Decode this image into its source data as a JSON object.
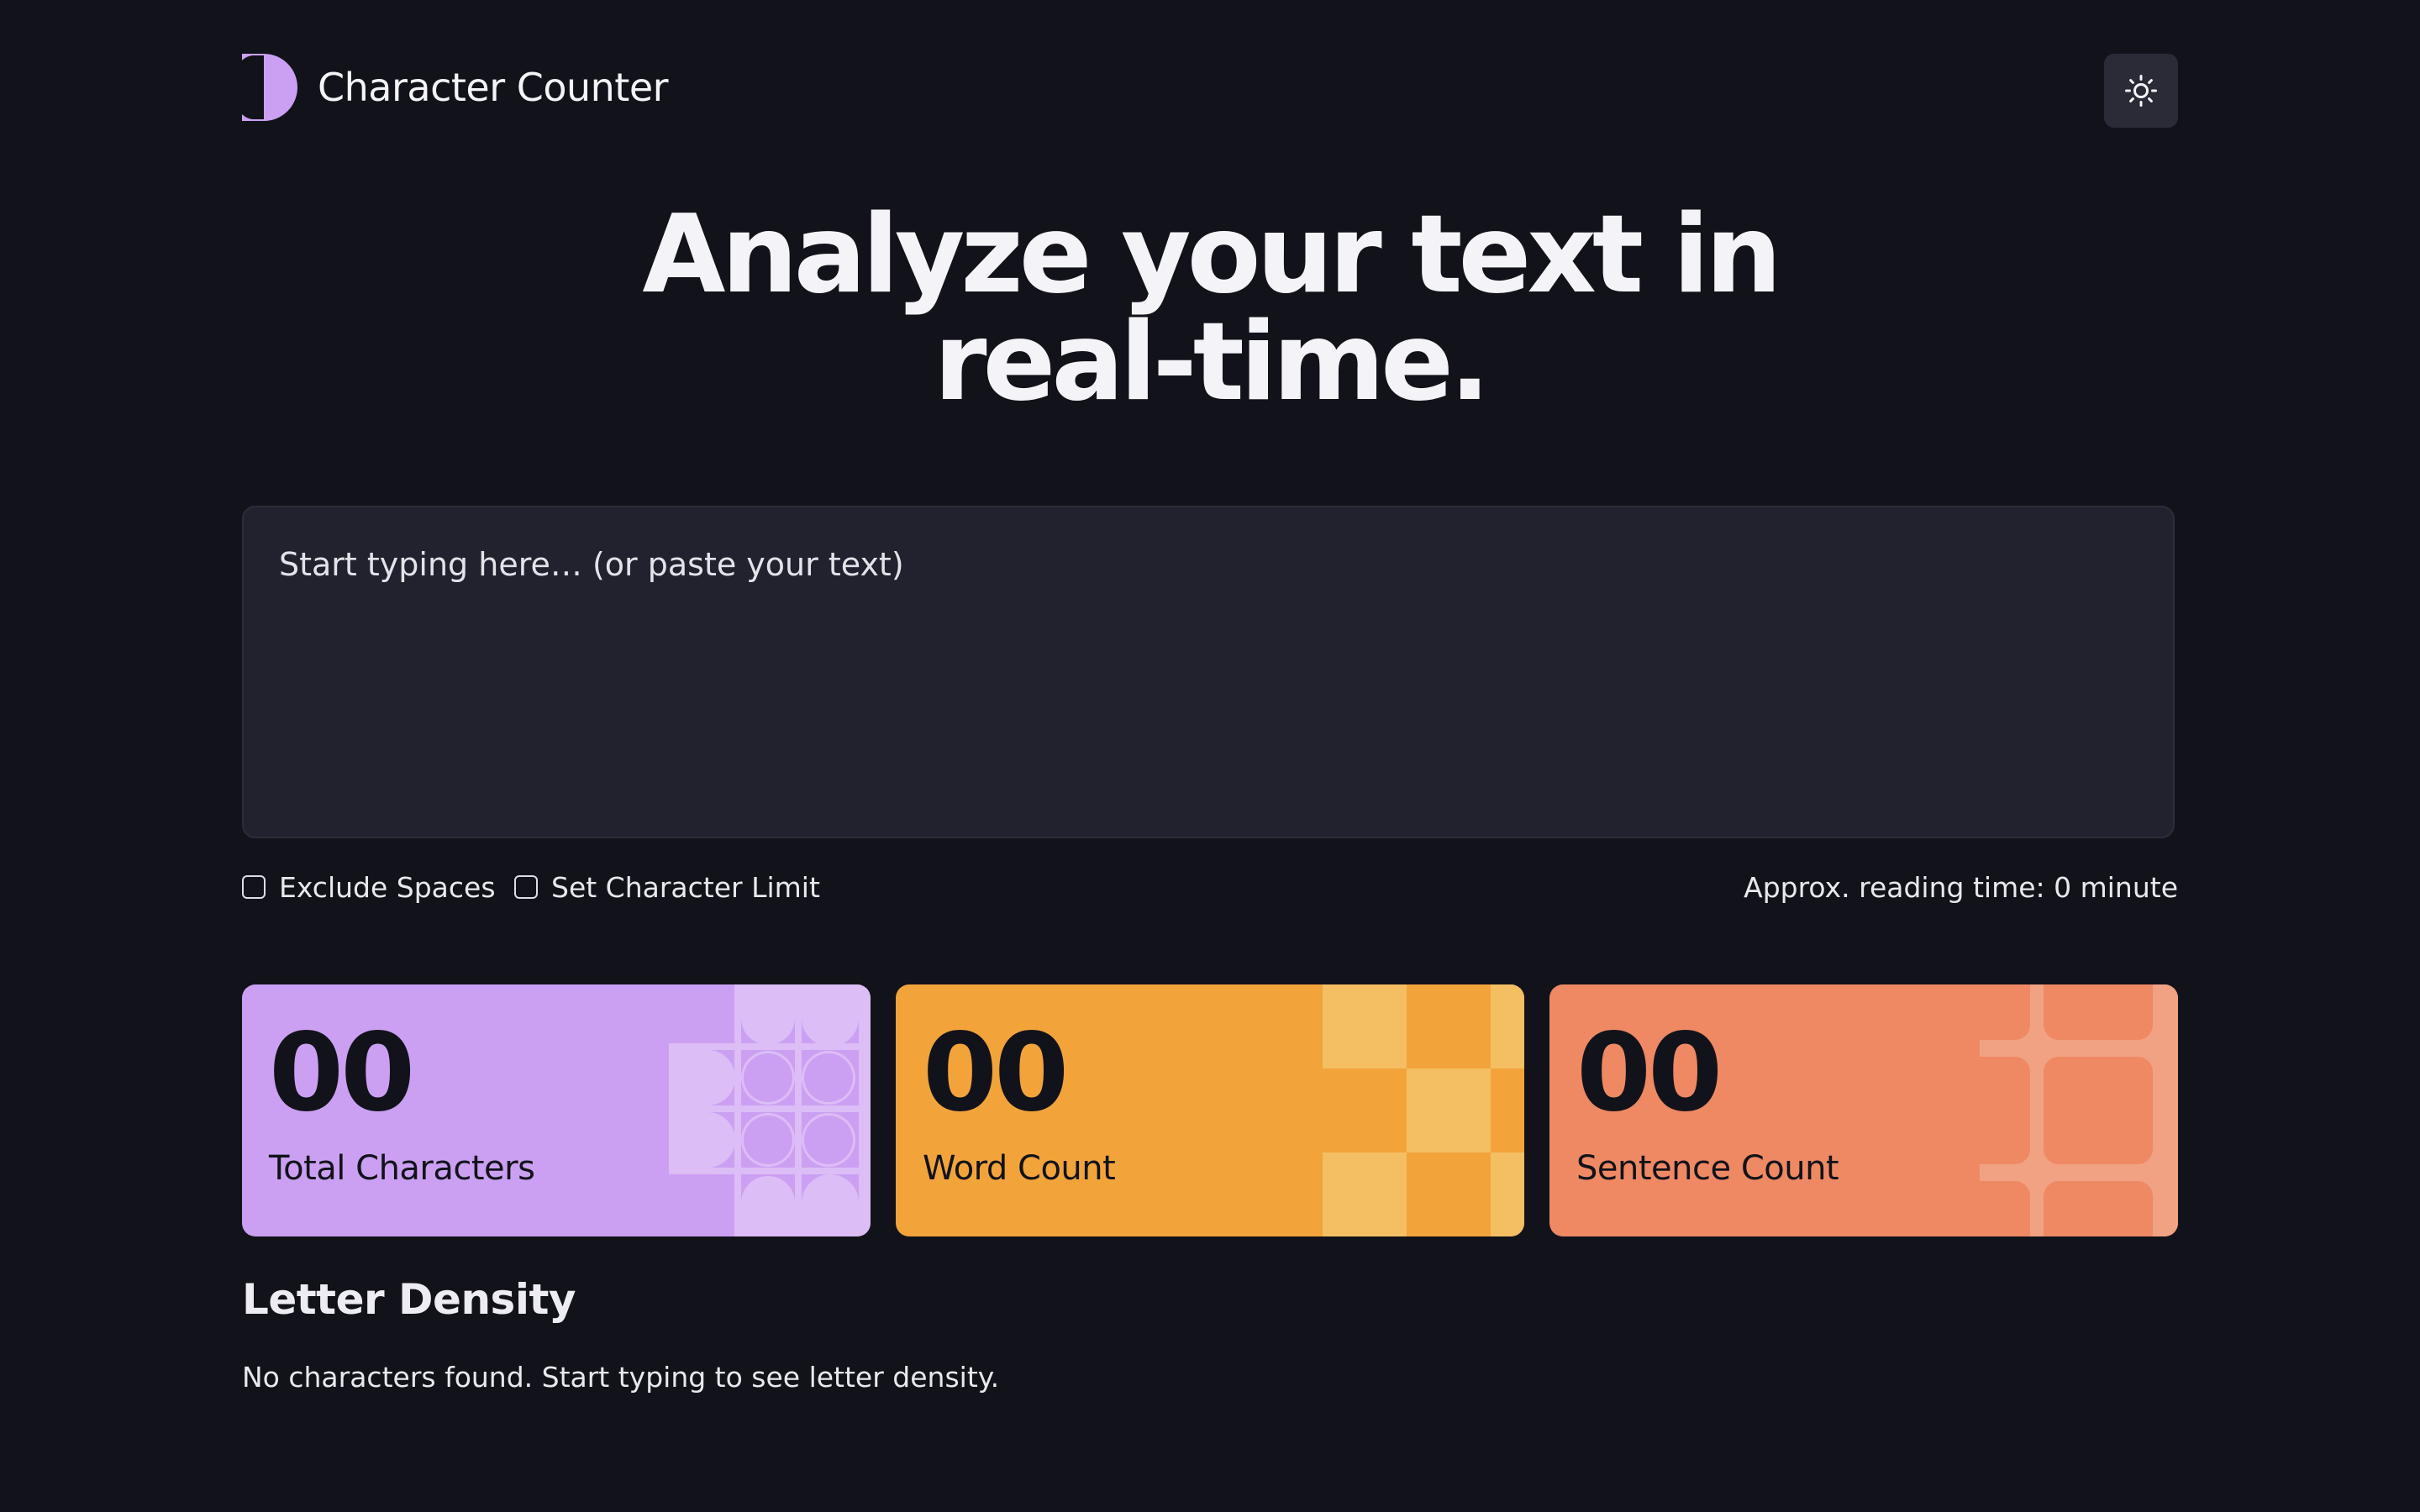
{
  "app": {
    "title": "Character Counter",
    "logo_icon": "half-moon-logo-icon",
    "theme_toggle_icon": "sun-icon"
  },
  "hero": {
    "line1": "Analyze your text in",
    "line2": "real-time."
  },
  "editor": {
    "value": "",
    "placeholder": "Start typing here… (or paste your text)"
  },
  "options": {
    "exclude_spaces_label": "Exclude Spaces",
    "exclude_spaces_checked": false,
    "char_limit_label": "Set Character Limit",
    "char_limit_checked": false,
    "reading_time": "Approx. reading time: 0 minute"
  },
  "stats": [
    {
      "value": "00",
      "label": "Total Characters",
      "color": "#cba0f2"
    },
    {
      "value": "00",
      "label": "Word Count",
      "color": "#f2a43b"
    },
    {
      "value": "00",
      "label": "Sentence Count",
      "color": "#ee8964"
    }
  ],
  "density": {
    "title": "Letter Density",
    "empty_message": "No characters found. Start typing to see letter density."
  },
  "colors": {
    "background": "#12131a",
    "surface": "#21222d",
    "accent": "#cba0f2"
  }
}
